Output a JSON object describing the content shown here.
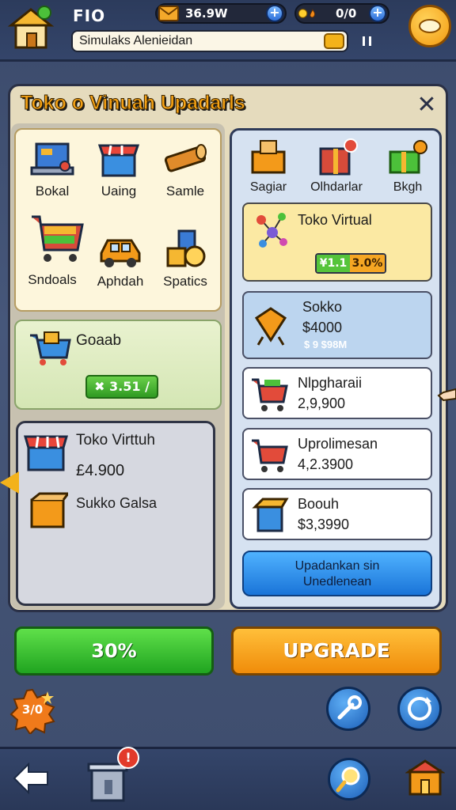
{
  "header": {
    "title": "FIO",
    "currency1": "36.9W",
    "currency2": "0/0",
    "search_text": "Simulaks Alenieidan"
  },
  "panel": {
    "title": "Toko o Vinuah Upadarls",
    "close": "✕"
  },
  "left_categories": [
    {
      "label": "Bokal",
      "icon": "laptop-icon"
    },
    {
      "label": "Uaing",
      "icon": "store-icon"
    },
    {
      "label": "Samle",
      "icon": "wood-icon"
    },
    {
      "label": "Sndoals",
      "icon": "cart-icon"
    },
    {
      "label": "Aphdah",
      "icon": "car-icon"
    },
    {
      "label": "Spatics",
      "icon": "cans-icon"
    }
  ],
  "promo": {
    "title": "Goaab",
    "badge": "✖ 3.51 /"
  },
  "store_box": {
    "name": "Toko Virttuh",
    "price": "£4.900",
    "sub": "Sukko Galsa"
  },
  "right_categories": [
    {
      "label": "Sagiar",
      "icon": "box-open-icon"
    },
    {
      "label": "Olhdarlar",
      "icon": "gift-icon"
    },
    {
      "label": "Bkgh",
      "icon": "green-gift-icon"
    }
  ],
  "featured": {
    "title": "Toko Virtual",
    "badge_left": "¥1.1",
    "badge_right": "3.0%"
  },
  "items": [
    {
      "name": "Sokko",
      "price": "$4000",
      "sub": "$ 9 $98M"
    },
    {
      "name": "Nlpgharaii",
      "price": "2,9,900"
    },
    {
      "name": "Uprolimesan",
      "price": "4,2.3900"
    },
    {
      "name": "Boouh",
      "price": "$3,3990"
    }
  ],
  "upgrade_all": {
    "line1": "Upadankan sin",
    "line2": "Unedlenean"
  },
  "buttons": {
    "percent": "30%",
    "upgrade": "UPGRADE"
  },
  "sale_badge": "3/0",
  "notification": "!",
  "colors": {
    "accent_orange": "#f6a214",
    "green": "#20a420",
    "blue": "#1a74d8",
    "panel_bg": "#e5dbbd"
  }
}
